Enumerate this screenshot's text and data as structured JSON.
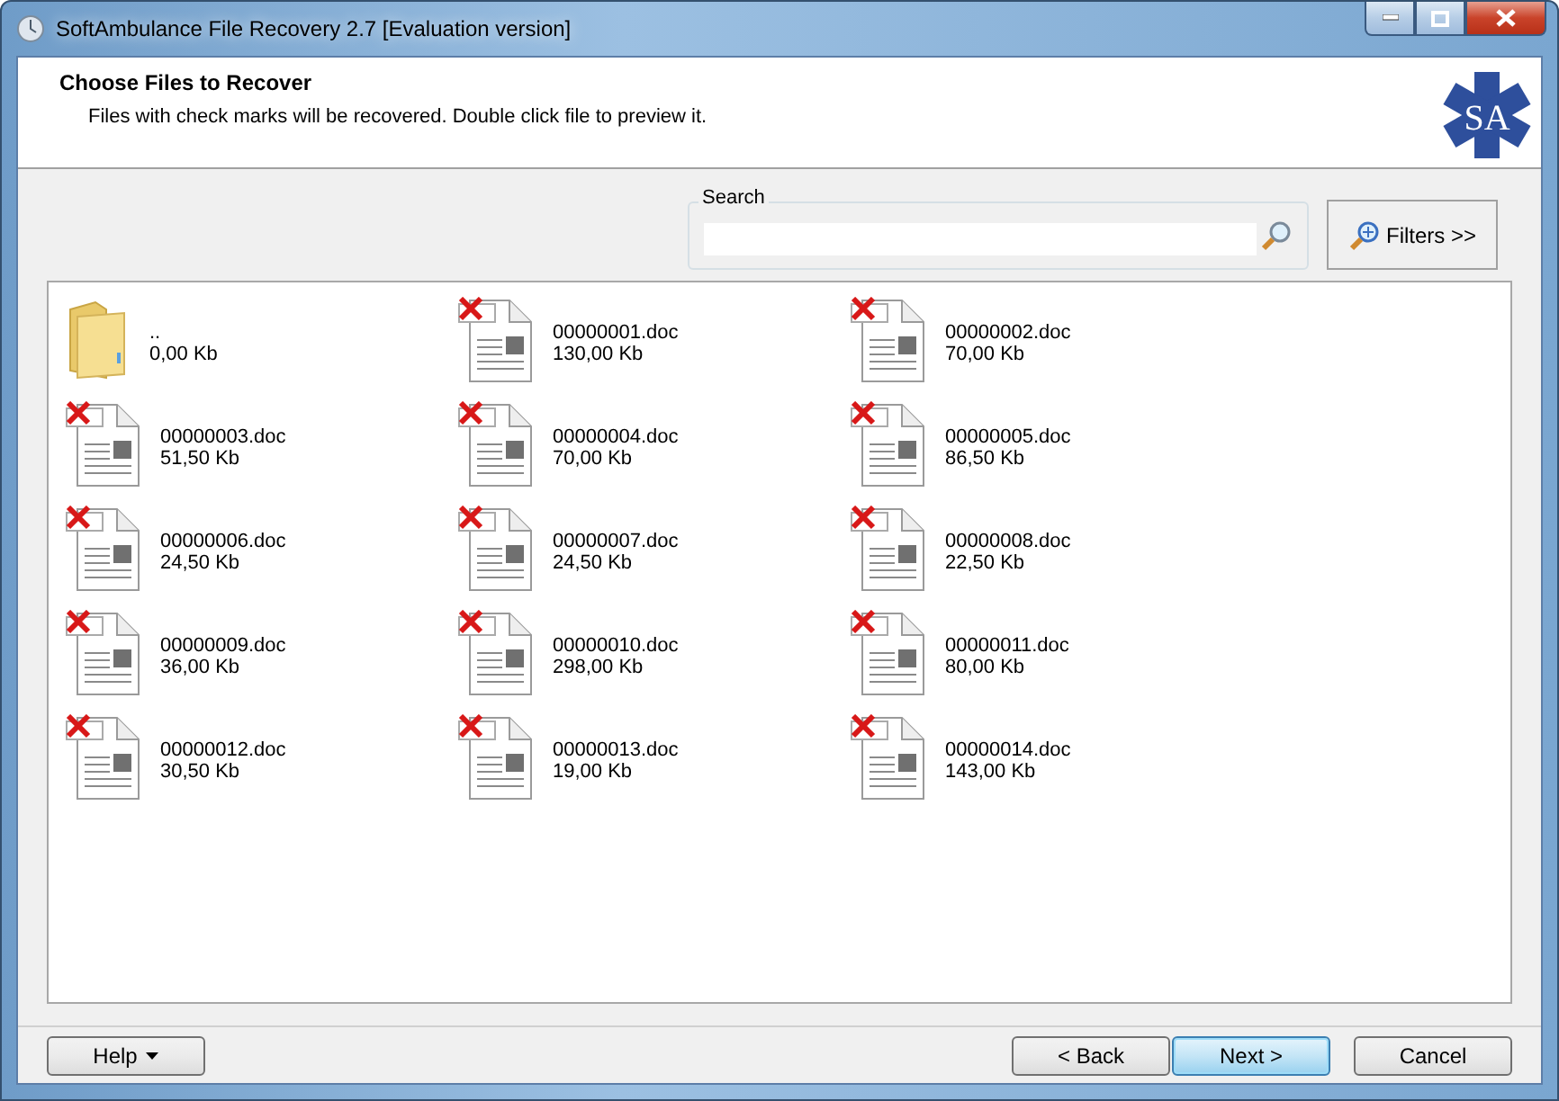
{
  "window": {
    "title": "SoftAmbulance File Recovery 2.7 [Evaluation version]"
  },
  "header": {
    "title": "Choose Files to Recover",
    "subtitle": "Files with check marks will be recovered. Double click file to preview it.",
    "logo_text": "SA"
  },
  "search": {
    "label": "Search"
  },
  "filters_button": "Filters >>",
  "files": [
    {
      "kind": "folder",
      "name": "..",
      "size": "0,00 Kb"
    },
    {
      "kind": "deleted-doc",
      "name": "00000001.doc",
      "size": "130,00 Kb"
    },
    {
      "kind": "deleted-doc",
      "name": "00000002.doc",
      "size": "70,00 Kb"
    },
    {
      "kind": "deleted-doc",
      "name": "00000003.doc",
      "size": "51,50 Kb"
    },
    {
      "kind": "deleted-doc",
      "name": "00000004.doc",
      "size": "70,00 Kb"
    },
    {
      "kind": "deleted-doc",
      "name": "00000005.doc",
      "size": "86,50 Kb"
    },
    {
      "kind": "deleted-doc",
      "name": "00000006.doc",
      "size": "24,50 Kb"
    },
    {
      "kind": "deleted-doc",
      "name": "00000007.doc",
      "size": "24,50 Kb"
    },
    {
      "kind": "deleted-doc",
      "name": "00000008.doc",
      "size": "22,50 Kb"
    },
    {
      "kind": "deleted-doc",
      "name": "00000009.doc",
      "size": "36,00 Kb"
    },
    {
      "kind": "deleted-doc",
      "name": "00000010.doc",
      "size": "298,00 Kb"
    },
    {
      "kind": "deleted-doc",
      "name": "00000011.doc",
      "size": "80,00 Kb"
    },
    {
      "kind": "deleted-doc",
      "name": "00000012.doc",
      "size": "30,50 Kb"
    },
    {
      "kind": "deleted-doc",
      "name": "00000013.doc",
      "size": "19,00 Kb"
    },
    {
      "kind": "deleted-doc",
      "name": "00000014.doc",
      "size": "143,00 Kb"
    }
  ],
  "help_button": "Help",
  "nav_buttons": [
    {
      "label": "< Back",
      "default": false
    },
    {
      "label": "Next >",
      "default": true
    },
    {
      "label": "Cancel",
      "default": false
    }
  ]
}
